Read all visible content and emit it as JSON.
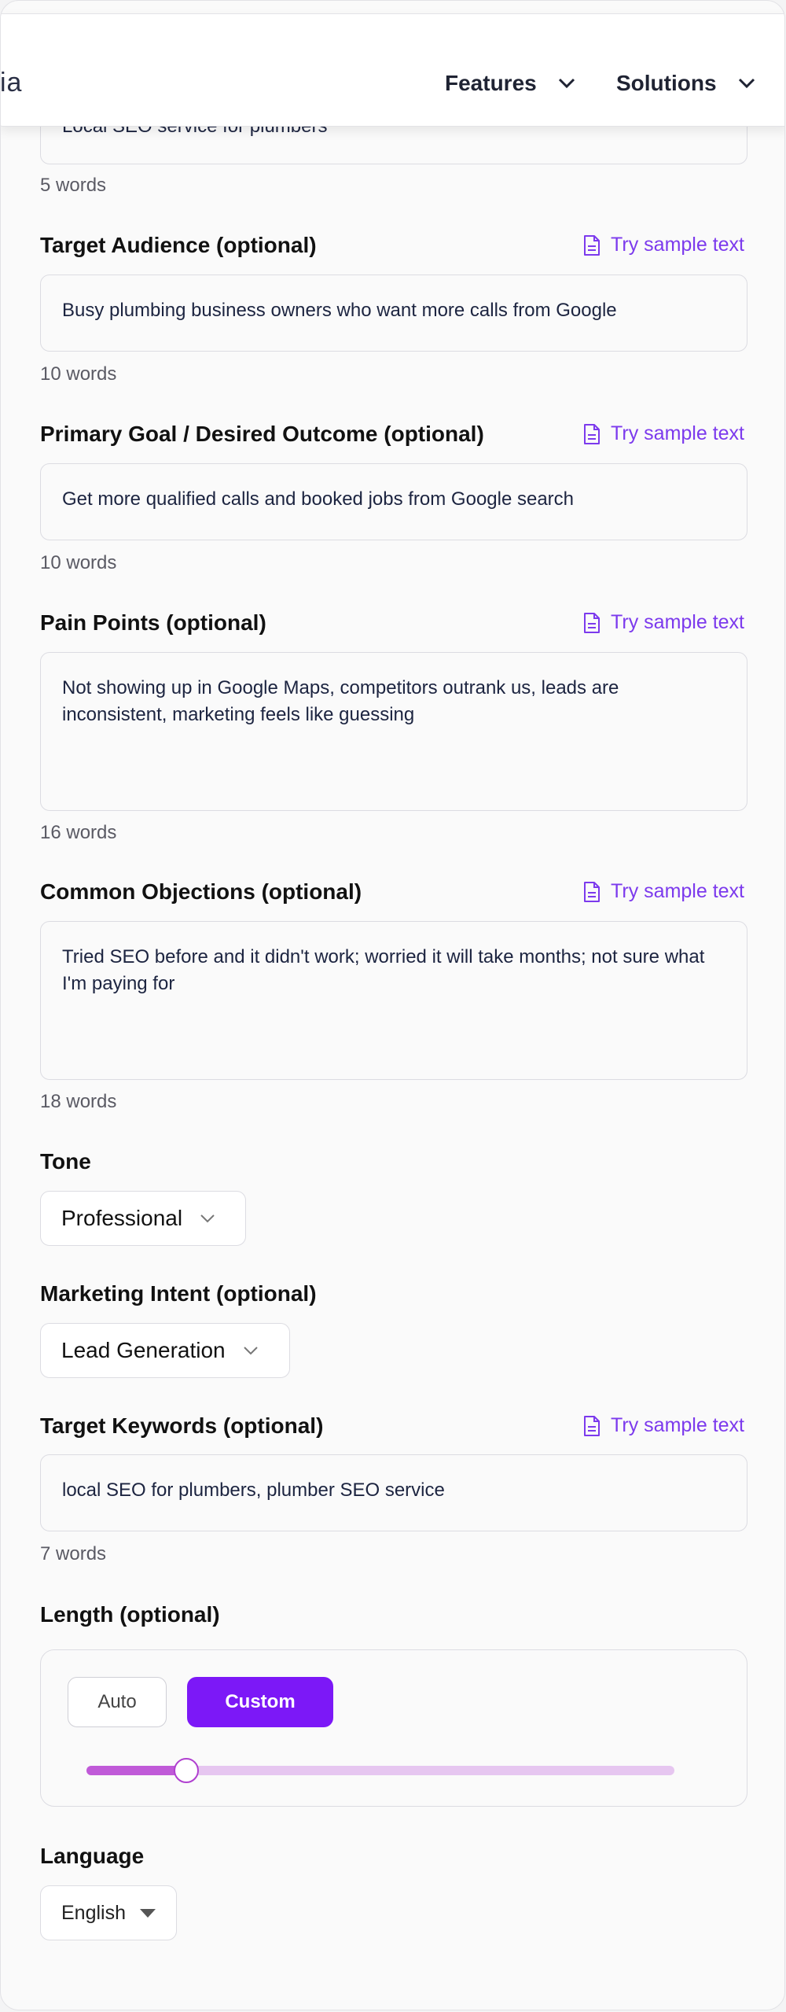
{
  "nav": {
    "logo_fragment": "ia",
    "items": [
      {
        "label": "Features"
      },
      {
        "label": "Solutions"
      }
    ]
  },
  "sample_link_label": "Try sample text",
  "fields": {
    "topic": {
      "value": "Local SEO service for plumbers",
      "word_count": "5 words"
    },
    "audience": {
      "label": "Target Audience (optional)",
      "value": "Busy plumbing business owners who want more calls from Google",
      "word_count": "10 words"
    },
    "goal": {
      "label": "Primary Goal / Desired Outcome (optional)",
      "value": "Get more qualified calls and booked jobs from Google search",
      "word_count": "10 words"
    },
    "pain_points": {
      "label": "Pain Points (optional)",
      "value": "Not showing up in Google Maps, competitors outrank us, leads are inconsistent, marketing feels like guessing",
      "word_count": "16 words"
    },
    "objections": {
      "label": "Common Objections (optional)",
      "value": "Tried SEO before and it didn't work; worried it will take months; not sure what I'm paying for",
      "word_count": "18 words"
    },
    "tone": {
      "label": "Tone",
      "value": "Professional"
    },
    "intent": {
      "label": "Marketing Intent (optional)",
      "value": "Lead Generation"
    },
    "keywords": {
      "label": "Target Keywords (optional)",
      "value": "local SEO for plumbers, plumber SEO service",
      "word_count": "7 words"
    },
    "length": {
      "label": "Length (optional)",
      "options": [
        {
          "label": "Auto",
          "selected": false
        },
        {
          "label": "Custom",
          "selected": true
        }
      ],
      "slider_fraction": 0.17
    },
    "language": {
      "label": "Language",
      "value": "English"
    }
  },
  "colors": {
    "accent": "#7c18f7",
    "link": "#7c3aed",
    "slider_fill": "#c05ad8",
    "slider_track": "#e6c6f0"
  }
}
